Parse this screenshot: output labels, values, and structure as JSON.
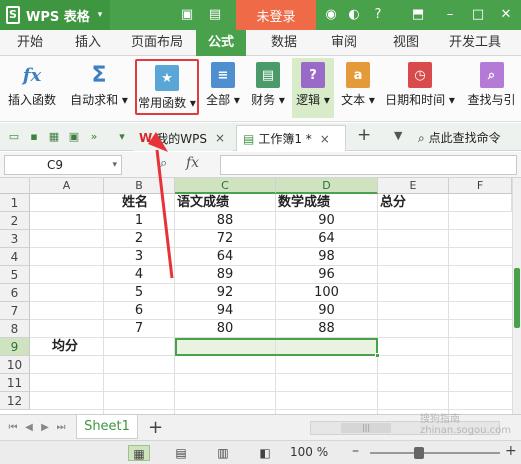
{
  "titlebar": {
    "app_name": "WPS 表格",
    "login_label": "未登录",
    "icons": [
      "restore-icon",
      "skin-icon",
      "feedback-icon",
      "help-icon",
      "minimize-icon",
      "window-icon",
      "close-icon"
    ]
  },
  "menubar": {
    "tabs": [
      "开始",
      "插入",
      "页面布局",
      "公式",
      "数据",
      "审阅",
      "视图",
      "开发工具"
    ],
    "active": "公式"
  },
  "ribbon": {
    "buttons": [
      {
        "label": "插入函数",
        "icon": "fx-icon"
      },
      {
        "label": "自动求和",
        "icon": "sigma-icon"
      },
      {
        "label": "常用函数",
        "icon": "star-book-icon"
      },
      {
        "label": "全部",
        "icon": "book-icon"
      },
      {
        "label": "财务",
        "icon": "finance-icon"
      },
      {
        "label": "逻辑",
        "icon": "logic-icon"
      },
      {
        "label": "文本",
        "icon": "text-icon"
      },
      {
        "label": "日期和时间",
        "icon": "clock-icon"
      },
      {
        "label": "查找与引",
        "icon": "lookup-icon"
      }
    ],
    "highlighted": "常用函数"
  },
  "toolbar": {
    "tab_mywps": "我的WPS",
    "tab_book": "工作簿1 *",
    "find_command": "点此查找命令",
    "close_glyph": "×",
    "add_glyph": "+"
  },
  "formulabar": {
    "cell_ref": "C9",
    "fx_label": "fx",
    "formula": ""
  },
  "sheet": {
    "columns": [
      "A",
      "B",
      "C",
      "D",
      "E",
      "F"
    ],
    "rows": [
      "1",
      "2",
      "3",
      "4",
      "5",
      "6",
      "7",
      "8",
      "9",
      "10",
      "11",
      "12"
    ],
    "header_row": {
      "B": "姓名",
      "C": "语文成绩",
      "D": "数学成绩",
      "E": "总分"
    },
    "data": [
      {
        "B": "1",
        "C": "88",
        "D": "90"
      },
      {
        "B": "2",
        "C": "72",
        "D": "64"
      },
      {
        "B": "3",
        "C": "64",
        "D": "98"
      },
      {
        "B": "4",
        "C": "89",
        "D": "96"
      },
      {
        "B": "5",
        "C": "92",
        "D": "100"
      },
      {
        "B": "6",
        "C": "94",
        "D": "90"
      },
      {
        "B": "7",
        "C": "80",
        "D": "88"
      }
    ],
    "row9_label": "均分",
    "selection": "C9:D9"
  },
  "sheetbar": {
    "sheet_name": "Sheet1",
    "add_glyph": "+"
  },
  "statusbar": {
    "zoom": "100 %"
  },
  "watermark": "搜狗指南 zhinan.sogou.com",
  "colors": {
    "brand_green": "#4aa14b",
    "login_orange": "#ef6a47",
    "highlight_red": "#e23b3b",
    "arrow_red": "#e8323a"
  }
}
